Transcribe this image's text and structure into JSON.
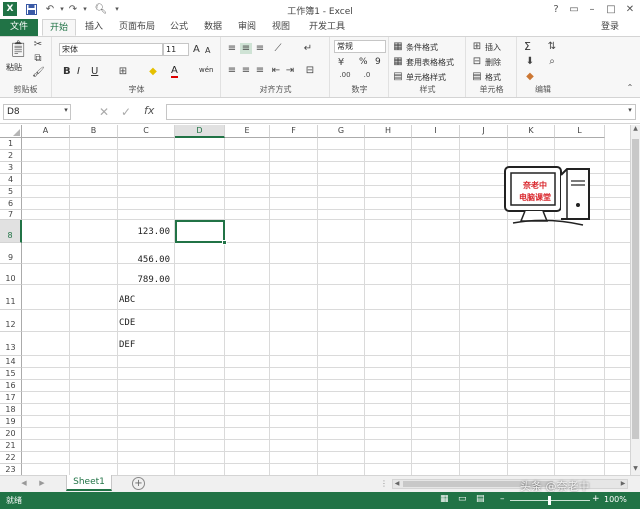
{
  "titlebar": {
    "title": "工作簿1 - Excel",
    "login": "登录",
    "minimize": "–",
    "restore": "□",
    "close": "✕",
    "help": "?",
    "ribbon_options": "▭"
  },
  "tabs": [
    "文件",
    "开始",
    "插入",
    "页面布局",
    "公式",
    "数据",
    "审阅",
    "视图",
    "开发工具"
  ],
  "ribbon": {
    "clipboard": {
      "paste": "粘贴",
      "label": "剪贴板"
    },
    "font": {
      "name": "宋体",
      "size": "11",
      "bold": "B",
      "italic": "I",
      "underline": "U",
      "label": "字体",
      "grow": "A",
      "shrink": "A",
      "wen": "wén"
    },
    "alignment": {
      "label": "对齐方式"
    },
    "number": {
      "format": "常规",
      "percent": "%",
      "comma": "9",
      "label": "数字"
    },
    "styles": {
      "conditional": "条件格式",
      "table": "套用表格格式",
      "cell": "单元格样式",
      "label": "样式"
    },
    "cells": {
      "insert": "插入",
      "delete": "删除",
      "format": "格式",
      "label": "单元格"
    },
    "editing": {
      "label": "编辑",
      "sum": "Σ"
    }
  },
  "formula_bar": {
    "name_box": "D8",
    "fx": "fx",
    "value": ""
  },
  "columns": [
    "A",
    "B",
    "C",
    "D",
    "E",
    "F",
    "G",
    "H",
    "I",
    "J",
    "K",
    "L"
  ],
  "rows": [
    "1",
    "2",
    "3",
    "4",
    "5",
    "6",
    "7",
    "8",
    "9",
    "10",
    "11",
    "12",
    "13",
    "14",
    "15",
    "16",
    "17",
    "18",
    "19",
    "20",
    "21",
    "22",
    "23"
  ],
  "cells": {
    "C8": "123.00",
    "C9": "456.00",
    "C10": "789.00",
    "C11": "ABC",
    "C12": "CDE",
    "C13": "DEF"
  },
  "logo": {
    "line1": "奈老中",
    "line2": "电脑课堂"
  },
  "sheets": {
    "active": "Sheet1",
    "add": "+"
  },
  "status": {
    "ready": "就绪",
    "zoom": "100%",
    "watermark": "头条 @奈老中"
  },
  "colors": {
    "accent": "#217346",
    "selection": "#217346",
    "logo_red": "#d9262c"
  }
}
